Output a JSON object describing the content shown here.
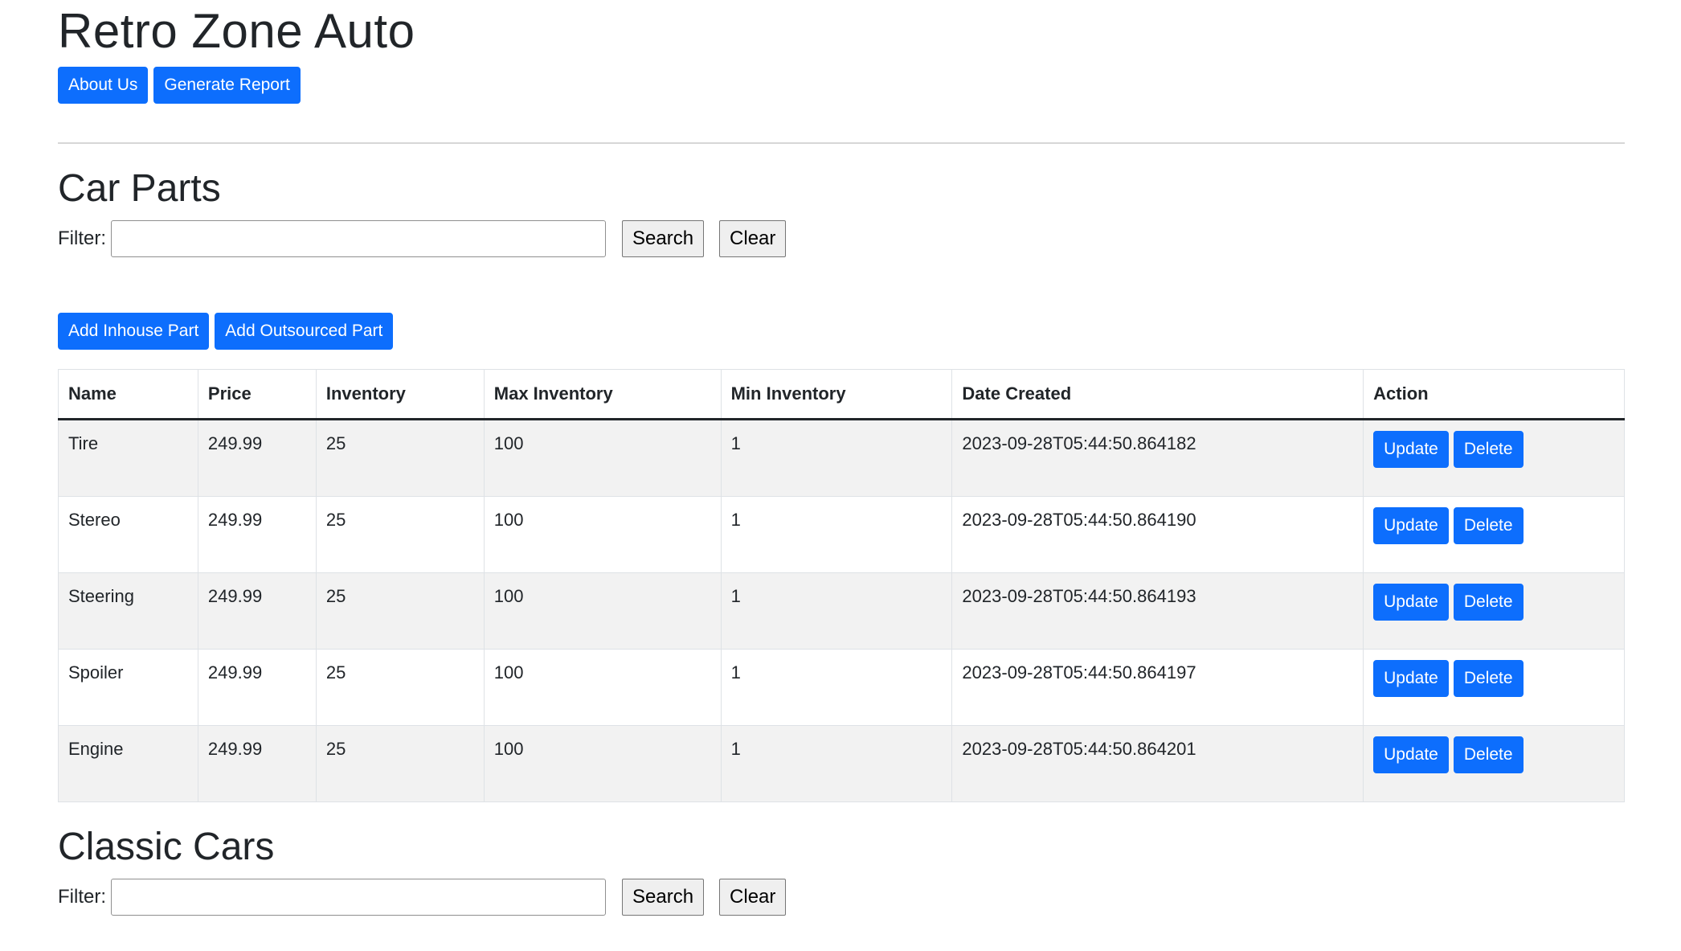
{
  "app": {
    "title": "Retro Zone Auto"
  },
  "header": {
    "about_label": "About Us",
    "report_label": "Generate Report"
  },
  "colors": {
    "primary": "#0d6efd",
    "row_stripe": "#f2f2f2"
  },
  "parts": {
    "title": "Car Parts",
    "filter_label": "Filter:",
    "filter_value": "",
    "search_label": "Search",
    "clear_label": "Clear",
    "add_inhouse_label": "Add Inhouse Part",
    "add_outsourced_label": "Add Outsourced Part",
    "columns": [
      "Name",
      "Price",
      "Inventory",
      "Max Inventory",
      "Min Inventory",
      "Date Created",
      "Action"
    ],
    "update_label": "Update",
    "delete_label": "Delete",
    "rows": [
      {
        "name": "Tire",
        "price": "249.99",
        "inventory": "25",
        "max": "100",
        "min": "1",
        "date": "2023-09-28T05:44:50.864182"
      },
      {
        "name": "Stereo",
        "price": "249.99",
        "inventory": "25",
        "max": "100",
        "min": "1",
        "date": "2023-09-28T05:44:50.864190"
      },
      {
        "name": "Steering",
        "price": "249.99",
        "inventory": "25",
        "max": "100",
        "min": "1",
        "date": "2023-09-28T05:44:50.864193"
      },
      {
        "name": "Spoiler",
        "price": "249.99",
        "inventory": "25",
        "max": "100",
        "min": "1",
        "date": "2023-09-28T05:44:50.864197"
      },
      {
        "name": "Engine",
        "price": "249.99",
        "inventory": "25",
        "max": "100",
        "min": "1",
        "date": "2023-09-28T05:44:50.864201"
      }
    ]
  },
  "cars": {
    "title": "Classic Cars",
    "filter_label": "Filter:",
    "filter_value": "",
    "search_label": "Search",
    "clear_label": "Clear"
  }
}
